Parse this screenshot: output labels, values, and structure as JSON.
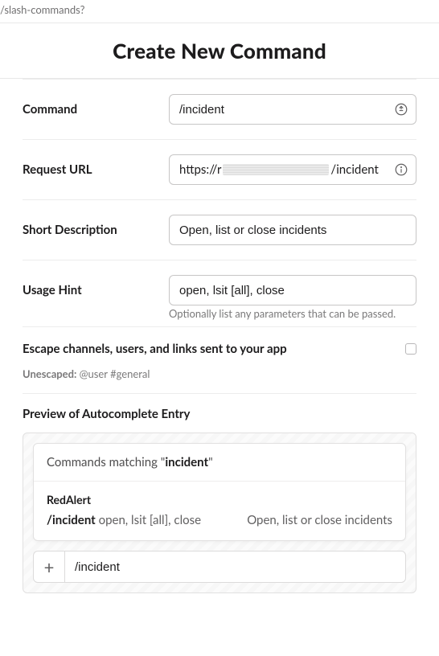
{
  "crumb": "/slash-commands?",
  "title": "Create New Command",
  "fields": {
    "command": {
      "label": "Command",
      "value": "/incident"
    },
    "requestUrl": {
      "label": "Request URL",
      "prefix": "https://r",
      "suffix": "/incident"
    },
    "shortDesc": {
      "label": "Short Description",
      "value": "Open, list or close incidents"
    },
    "usageHint": {
      "label": "Usage Hint",
      "value": "open, lsit [all], close",
      "hint": "Optionally list any parameters that can be passed."
    }
  },
  "escape": {
    "label": "Escape channels, users, and links sent to your app",
    "unescapedLabel": "Unescaped:",
    "unescapedValue": "@user #general",
    "checked": false
  },
  "preview": {
    "title": "Preview of Autocomplete Entry",
    "matchingPrefix": "Commands matching \"",
    "matchingTerm": "incident",
    "matchingSuffix": "\"",
    "appName": "RedAlert",
    "cmdBold": "/incident",
    "cmdRest": " open, lsit [all], close",
    "desc": "Open, list or close incidents",
    "composerValue": "/incident"
  }
}
